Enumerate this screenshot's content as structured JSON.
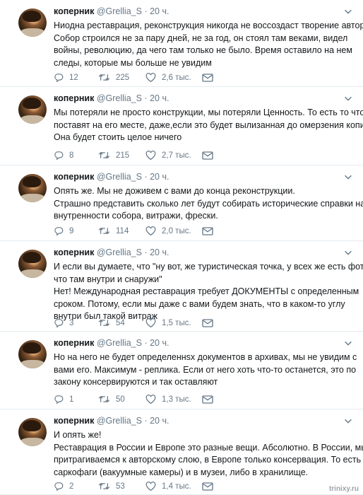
{
  "tweets": [
    {
      "name": "коперник",
      "handle": "@Grellia_S",
      "dot": "·",
      "time": "20 ч.",
      "lines": [
        "Ниодна реставрация, реконструкция никогда не воссоздаст творение автора.",
        "Собор строился не за пару дней, не за год, он стоял там веками, видел",
        "войны, революцию, да чего там только не было. Время оставило на нем",
        "следы, которые мы больше не увидим"
      ],
      "replies": "12",
      "retweets": "225",
      "likes": "2,6 тыс."
    },
    {
      "name": "коперник",
      "handle": "@Grellia_S",
      "dot": "·",
      "time": "20 ч.",
      "lines": [
        "Мы потеряли не просто конструкции, мы потеряли Ценность. То есть то что",
        "поставят на его месте, даже,если это будет вылизанная до омерзения копия.",
        "Она будет стоить целое ничего"
      ],
      "replies": "8",
      "retweets": "215",
      "likes": "2,7 тыс."
    },
    {
      "name": "коперник",
      "handle": "@Grellia_S",
      "dot": "·",
      "time": "20 ч.",
      "lines": [
        "Опять же. Мы не доживем с вами до конца реконструкции.",
        "Страшно представить сколько лет будут собирать исторические справки на",
        "внутренности собора, витражи, фрески."
      ],
      "replies": "9",
      "retweets": "114",
      "likes": "2,0 тыс."
    },
    {
      "name": "коперник",
      "handle": "@Grellia_S",
      "dot": "·",
      "time": "20 ч.",
      "lines": [
        "И если вы думаете, что \"ну вот, же туристическая точка, у всех же есть фотки",
        "что там внутри и снаружи\"",
        "Нет! Международная реставрация требует ДОКУМЕНТЫ с определенным",
        "сроком. Потому, если мы даже с вами будем знать, что в каком-то углу",
        "внутри был такой витраж"
      ],
      "replies": "3",
      "retweets": "54",
      "likes": "1,5 тыс."
    },
    {
      "name": "коперник",
      "handle": "@Grellia_S",
      "dot": "·",
      "time": "20 ч.",
      "lines": [
        "Но на него не будет определеннsх документов в архивах, мы не увидим с",
        "вами его. Максимум - реплика. Если от него хоть что-то останется, это по",
        "закону консервируются и так оставляют"
      ],
      "replies": "1",
      "retweets": "50",
      "likes": "1,3 тыс."
    },
    {
      "name": "коперник",
      "handle": "@Grellia_S",
      "dot": "·",
      "time": "20 ч.",
      "lines": [
        "И опять же!",
        "Реставрация в России и Европе это разные вещи. Абсолютно. В России, мы",
        "притрагиваемся к авторскому слою, в Европе только консервация. То есть в",
        "саркофаги (вакуумные камеры) и в музеи, либо в хранилище."
      ],
      "replies": "2",
      "retweets": "53",
      "likes": "1,4 тыс."
    }
  ],
  "watermark": "trinixy.ru",
  "colors": {
    "text": "#14171a",
    "muted": "#657786",
    "border": "#e6ecf0"
  }
}
